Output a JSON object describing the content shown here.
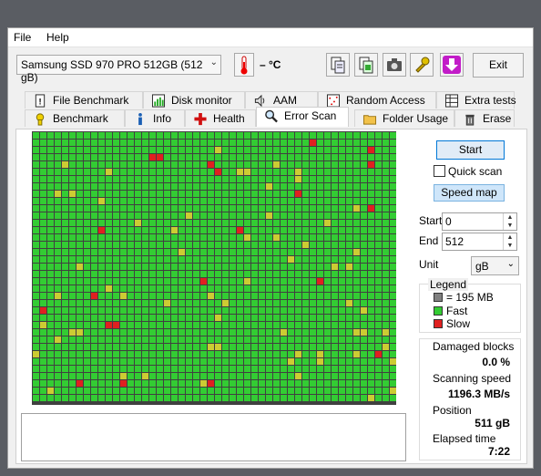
{
  "menu": {
    "file": "File",
    "help": "Help"
  },
  "toolbar": {
    "drive": "Samsung SSD 970 PRO 512GB (512 gB)",
    "temperature": "– °C",
    "exit": "Exit"
  },
  "tabs_top": [
    {
      "label": "File Benchmark",
      "icon": "file-benchmark-icon"
    },
    {
      "label": "Disk monitor",
      "icon": "disk-monitor-icon"
    },
    {
      "label": "AAM",
      "icon": "speaker-icon"
    },
    {
      "label": "Random Access",
      "icon": "random-access-icon"
    },
    {
      "label": "Extra tests",
      "icon": "extra-tests-icon"
    }
  ],
  "tabs_bottom": [
    {
      "label": "Benchmark",
      "icon": "benchmark-icon"
    },
    {
      "label": "Info",
      "icon": "info-icon"
    },
    {
      "label": "Health",
      "icon": "health-icon"
    },
    {
      "label": "Error Scan",
      "icon": "magnifier-icon"
    },
    {
      "label": "Folder Usage",
      "icon": "folder-icon"
    },
    {
      "label": "Erase",
      "icon": "trash-icon"
    }
  ],
  "scan": {
    "start_button": "Start",
    "quick_scan": "Quick scan",
    "quick_scan_checked": false,
    "speed_map": "Speed map",
    "start_label": "Start",
    "start_value": "0",
    "end_label": "End",
    "end_value": "512",
    "unit_label": "Unit",
    "unit_value": "gB"
  },
  "legend": {
    "title": "Legend",
    "block": "= 195 MB",
    "fast": "Fast",
    "slow": "Slow",
    "colors": {
      "block": "#808080",
      "fast": "#33cc33",
      "slow": "#e02020",
      "medium": "#cccc33"
    }
  },
  "stats": {
    "damaged_label": "Damaged blocks",
    "damaged_value": "0.0 %",
    "speed_label": "Scanning speed",
    "speed_value": "1196.3 MB/s",
    "position_label": "Position",
    "position_value": "511 gB",
    "elapsed_label": "Elapsed time",
    "elapsed_value": "7:22"
  }
}
